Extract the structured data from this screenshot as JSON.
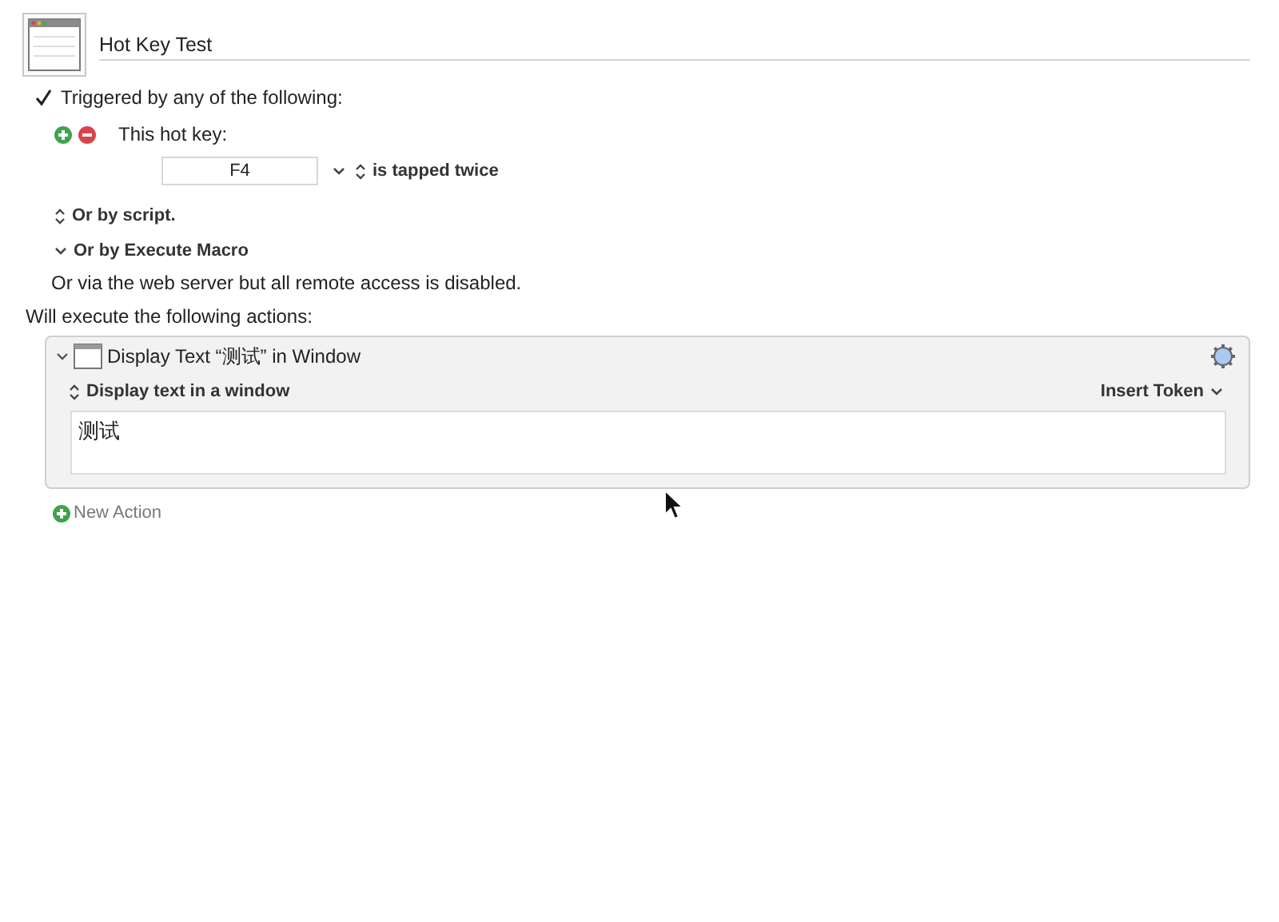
{
  "macro": {
    "name": "Hot Key Test"
  },
  "trigger_group": {
    "label": "Triggered by any of the following:",
    "checked": true
  },
  "hotkey_trigger": {
    "label": "This hot key:",
    "key": "F4",
    "mode": "is tapped twice"
  },
  "options": [
    {
      "kind": "popup",
      "label": "Or by script."
    },
    {
      "kind": "disclosure",
      "label": "Or by Execute Macro"
    }
  ],
  "web_note": "Or via the web server but all remote access is disabled.",
  "actions_heading": "Will execute the following actions:",
  "actions": [
    {
      "title": "Display Text “测试” in Window",
      "expanded": true,
      "mode": "Display text in a window",
      "token_menu": "Insert Token",
      "text": "测试"
    }
  ],
  "new_action": "New Action"
}
